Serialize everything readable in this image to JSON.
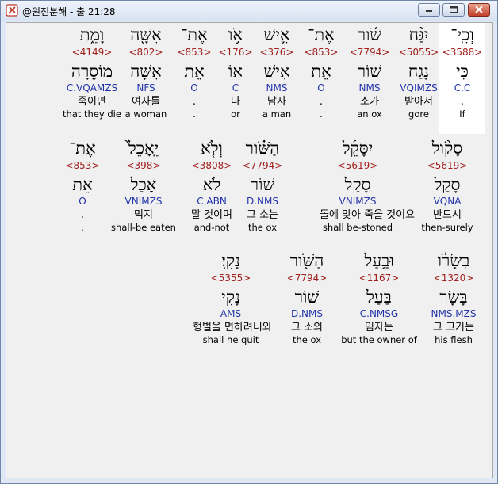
{
  "window": {
    "title": "@원전분해 - 출 21:28"
  },
  "rows": [
    {
      "words": [
        {
          "heb": "וְכִֽי־",
          "strong": "<3588>",
          "lemma": "כִּי",
          "morph": "C.C",
          "kor": ".",
          "eng": "If",
          "hl": true
        },
        {
          "heb": "יִגַּ֨ח",
          "strong": "<5055>",
          "lemma": "נָגַח",
          "morph": "VQIMZS",
          "kor": "받아서",
          "eng": "gore"
        },
        {
          "heb": "שֹׁ֜ור",
          "strong": "<7794>",
          "lemma": "שׁוֹר",
          "morph": "NMS",
          "kor": "소가",
          "eng": "an ox"
        },
        {
          "heb": "אֶת־",
          "strong": "<853>",
          "lemma": "אֵת",
          "morph": "O",
          "kor": ".",
          "eng": "."
        },
        {
          "heb": "אִ֛ישׁ",
          "strong": "<376>",
          "lemma": "אִישׁ",
          "morph": "NMS",
          "kor": "남자",
          "eng": "a man"
        },
        {
          "heb": "אֹ֥ו",
          "strong": "<176>",
          "lemma": "אוֹ",
          "morph": "C",
          "kor": "나",
          "eng": "or"
        },
        {
          "heb": "אֶת־",
          "strong": "<853>",
          "lemma": "אֵת",
          "morph": "O",
          "kor": ".",
          "eng": "."
        },
        {
          "heb": "אִשָּׁ֖ה",
          "strong": "<802>",
          "lemma": "אִשָּׁה",
          "morph": "NFS",
          "kor": "여자를",
          "eng": "a woman"
        },
        {
          "heb": "וָמֵ֑ת",
          "strong": "<4149>",
          "lemma": "מוֹסֵרָה",
          "morph": "C.VQAMZS",
          "kor": "죽이면",
          "eng": "that they die"
        }
      ]
    },
    {
      "words": [
        {
          "heb": "סָקֹ֨ול",
          "strong": "<5619>",
          "lemma": "סָקַל",
          "morph": "VQNA",
          "kor": "반드시",
          "eng": "then-surely"
        },
        {
          "heb": "יִסָּקֵ֜ל",
          "strong": "<5619>",
          "lemma": "סָקַל",
          "morph": "VNIMZS",
          "kor": "돌에 맞아 죽을 것이요",
          "eng": "shall be-stoned"
        },
        {
          "heb": "הַשֹּׁ֗ור",
          "strong": "<7794>",
          "lemma": "שׁוֹר",
          "morph": "D.NMS",
          "kor": "그 소는",
          "eng": "the ox"
        },
        {
          "heb": "וְלֹ֤א",
          "strong": "<3808>",
          "lemma": "לֹא",
          "morph": "C.ABN",
          "kor": "말 것이며",
          "eng": "and-not"
        },
        {
          "heb": "יֵֽאָכֵל֙",
          "strong": "<398>",
          "lemma": "אָכַל",
          "morph": "VNIMZS",
          "kor": "먹지",
          "eng": "shall-be eaten"
        },
        {
          "heb": "אֶת־",
          "strong": "<853>",
          "lemma": "אֵת",
          "morph": "O",
          "kor": ".",
          "eng": "."
        }
      ]
    },
    {
      "words": [
        {
          "heb": "בְּשָׂרֹ֔ו",
          "strong": "<1320>",
          "lemma": "בָּשָׂר",
          "morph": "NMS.MZS",
          "kor": "그 고기는",
          "eng": "his flesh"
        },
        {
          "heb": "וּבַ֥עַל",
          "strong": "<1167>",
          "lemma": "בַּעַל",
          "morph": "C.NMSG",
          "kor": "임자는",
          "eng": "but the owner of"
        },
        {
          "heb": "הַשֹּׁ֖ור",
          "strong": "<7794>",
          "lemma": "שׁוֹר",
          "morph": "D.NMS",
          "kor": "그 소의",
          "eng": "the ox"
        },
        {
          "heb": "נָקִֽי׃",
          "strong": "<5355>",
          "lemma": "נָקִי",
          "morph": "AMS",
          "kor": "형벌을 면하려니와",
          "eng": "shall he quit"
        }
      ]
    }
  ]
}
